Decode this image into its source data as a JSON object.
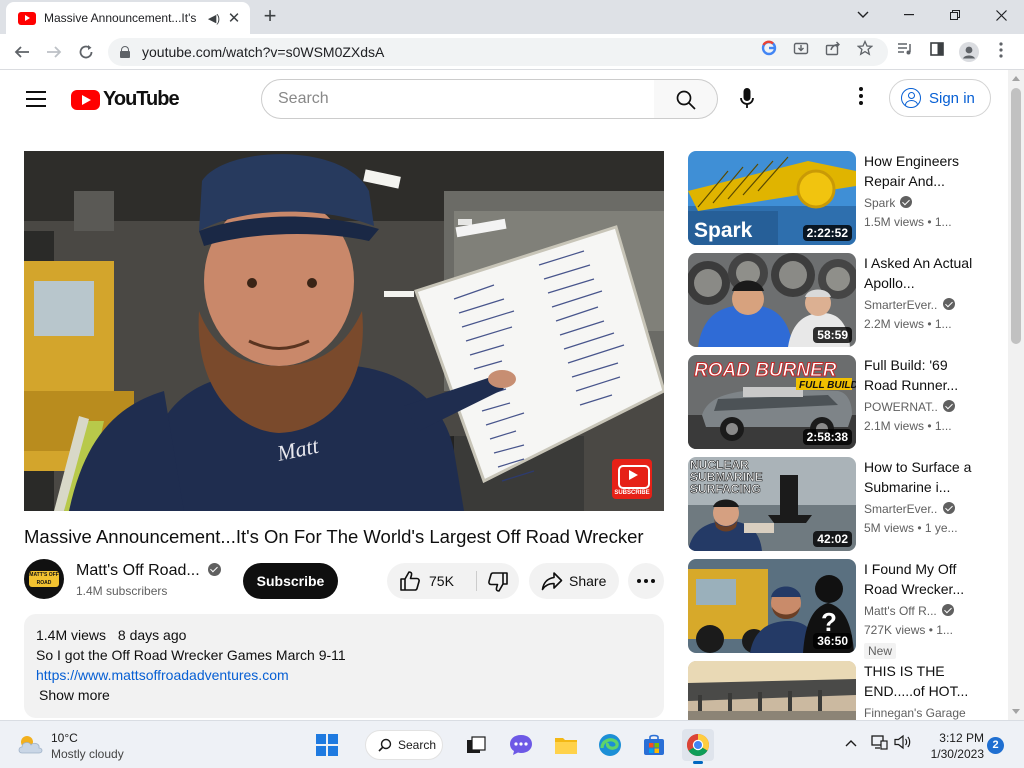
{
  "browser": {
    "tab_title": "Massive Announcement...It's",
    "url": "youtube.com/watch?v=s0WSM0ZXdsA"
  },
  "youtube": {
    "logo_text": "YouTube",
    "search_placeholder": "Search",
    "signin_label": "Sign in"
  },
  "video": {
    "watermark_text": "SUBSCRIBE",
    "title": "Massive Announcement...It's On For The World's Largest Off Road Wrecker",
    "channel_name": "Matt's Off Road...",
    "channel_badge_text": "MATT'S OFF ROAD",
    "subscribers": "1.4M subscribers",
    "subscribe_label": "Subscribe",
    "likes": "75K",
    "share_label": "Share",
    "views": "1.4M views",
    "age": "8 days ago",
    "description_line": "So I got the Off Road Wrecker Games March 9-11",
    "description_link": "https://www.mattsoffroadadventures.com",
    "show_more": "Show more"
  },
  "recommendations": [
    {
      "title": "How Engineers Repair And...",
      "channel": "Spark",
      "verified": true,
      "stats": "1.5M views • 1...",
      "duration": "2:22:52",
      "thumb_text": "Spark"
    },
    {
      "title": "I Asked An Actual Apollo...",
      "channel": "SmarterEver...",
      "verified": true,
      "stats": "2.2M views • 1...",
      "duration": "58:59"
    },
    {
      "title": "Full Build: '69 Road Runner...",
      "channel": "POWERNAT...",
      "verified": true,
      "stats": "2.1M views • 1...",
      "duration": "2:58:38",
      "thumb_text": "ROAD BURNER",
      "thumb_sub": "FULL BUILD"
    },
    {
      "title": "How to Surface a Submarine i...",
      "channel": "SmarterEver...",
      "verified": true,
      "stats": "5M views • 1 ye...",
      "duration": "42:02",
      "thumb_text": "NUCLEAR SUBMARINE SURFACING"
    },
    {
      "title": "I Found My Off Road Wrecker...",
      "channel": "Matt's Off R...",
      "verified": true,
      "stats": "727K views • 1...",
      "duration": "36:50",
      "badge": "New"
    },
    {
      "title": "THIS IS THE END.....of HOT...",
      "channel": "Finnegan's Garage",
      "verified": false,
      "stats": ""
    }
  ],
  "taskbar": {
    "temperature": "10°C",
    "condition": "Mostly cloudy",
    "search_label": "Search",
    "time": "3:12 PM",
    "date": "1/30/2023",
    "notification_count": "2"
  }
}
